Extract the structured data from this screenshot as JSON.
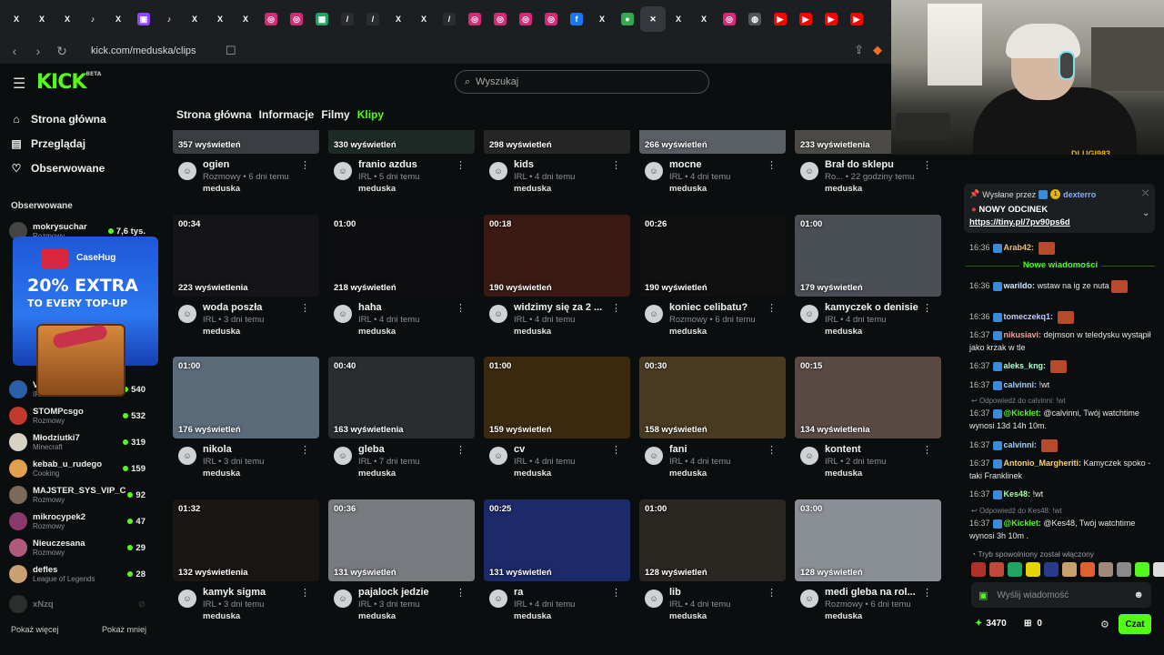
{
  "browser": {
    "tabs": [
      {
        "icon": "x-icon",
        "glyph": "X",
        "color": "#1c1f22"
      },
      {
        "icon": "x-icon",
        "glyph": "X",
        "color": "#1c1f22"
      },
      {
        "icon": "x-icon",
        "glyph": "X",
        "color": "#1c1f22"
      },
      {
        "icon": "tiktok-icon",
        "glyph": "♪",
        "color": "#1c1f22"
      },
      {
        "icon": "x-icon",
        "glyph": "X",
        "color": "#1c1f22"
      },
      {
        "icon": "twitch-icon",
        "glyph": "▣",
        "color": "#9146ff"
      },
      {
        "icon": "tiktok-icon",
        "glyph": "♪",
        "color": "#1c1f22"
      },
      {
        "icon": "x-icon",
        "glyph": "X",
        "color": "#1c1f22"
      },
      {
        "icon": "x-icon",
        "glyph": "X",
        "color": "#1c1f22"
      },
      {
        "icon": "x-icon",
        "glyph": "X",
        "color": "#1c1f22"
      },
      {
        "icon": "instagram-icon",
        "glyph": "◎",
        "color": "#d62976"
      },
      {
        "icon": "instagram-icon",
        "glyph": "◎",
        "color": "#d62976"
      },
      {
        "icon": "sheets-icon",
        "glyph": "▦",
        "color": "#1fa463"
      },
      {
        "icon": "stream-icon",
        "glyph": "/",
        "color": "#2a2d30"
      },
      {
        "icon": "stream-icon",
        "glyph": "/",
        "color": "#2a2d30"
      },
      {
        "icon": "x-icon",
        "glyph": "X",
        "color": "#1c1f22"
      },
      {
        "icon": "x-icon",
        "glyph": "X",
        "color": "#1c1f22"
      },
      {
        "icon": "stream-icon",
        "glyph": "/",
        "color": "#2a2d30"
      },
      {
        "icon": "instagram-icon",
        "glyph": "◎",
        "color": "#d62976"
      },
      {
        "icon": "instagram-icon",
        "glyph": "◎",
        "color": "#d62976"
      },
      {
        "icon": "instagram-icon",
        "glyph": "◎",
        "color": "#d62976"
      },
      {
        "icon": "instagram-icon",
        "glyph": "◎",
        "color": "#d62976"
      },
      {
        "icon": "facebook-icon",
        "glyph": "f",
        "color": "#1877f2"
      },
      {
        "icon": "x-icon",
        "glyph": "X",
        "color": "#1c1f22"
      },
      {
        "icon": "chrome-icon",
        "glyph": "●",
        "color": "#34a853"
      },
      {
        "icon": "close-icon",
        "glyph": "✕",
        "color": "#35393d",
        "active": true
      },
      {
        "icon": "x-icon",
        "glyph": "X",
        "color": "#1c1f22"
      },
      {
        "icon": "x-icon",
        "glyph": "X",
        "color": "#1c1f22"
      },
      {
        "icon": "instagram-icon",
        "glyph": "◎",
        "color": "#d62976"
      },
      {
        "icon": "globe-icon",
        "glyph": "◍",
        "color": "#555"
      },
      {
        "icon": "youtube-icon",
        "glyph": "▶",
        "color": "#ff0000"
      },
      {
        "icon": "youtube-icon",
        "glyph": "▶",
        "color": "#ff0000"
      },
      {
        "icon": "youtube-icon",
        "glyph": "▶",
        "color": "#ff0000"
      },
      {
        "icon": "youtube-icon",
        "glyph": "▶",
        "color": "#ff0000"
      }
    ],
    "url": "kick.com/meduska/clips"
  },
  "brand": {
    "logo": "KICK",
    "beta": "BETA",
    "accent": "#53fc18"
  },
  "nav": [
    {
      "label": "Strona główna",
      "icon": "home-icon",
      "glyph": "⌂"
    },
    {
      "label": "Przeglądaj",
      "icon": "browse-icon",
      "glyph": "▤"
    },
    {
      "label": "Obserwowane",
      "icon": "heart-icon",
      "glyph": "♡"
    }
  ],
  "followed": {
    "heading": "Obserwowane",
    "channels": [
      {
        "name": "mokrysuchar",
        "category": "Rozmowy",
        "count": "7,6 tys.",
        "color": "#444"
      },
      {
        "name": "Voo",
        "category": "IRL",
        "count": "540",
        "color": "#2b5fa8"
      },
      {
        "name": "STOMPcsgo",
        "category": "Rozmowy",
        "count": "532",
        "color": "#c0392b"
      },
      {
        "name": "Młodziutki7",
        "category": "Minecraft",
        "count": "319",
        "color": "#d8d2c4"
      },
      {
        "name": "kebab_u_rudego",
        "category": "Cooking",
        "count": "159",
        "color": "#e0a050"
      },
      {
        "name": "MAJSTER_SYS_VIP_C",
        "category": "Rozmowy",
        "count": "92",
        "color": "#7a6a5a"
      },
      {
        "name": "mikrocypek2",
        "category": "Rozmowy",
        "count": "47",
        "color": "#8a3a6a"
      },
      {
        "name": "Nieuczesana",
        "category": "Rozmowy",
        "count": "29",
        "color": "#b05a7a"
      },
      {
        "name": "defles",
        "category": "League of Legends",
        "count": "28",
        "color": "#c9a070"
      },
      {
        "name": "xNzq",
        "category": "",
        "count": "",
        "color": "#555"
      }
    ],
    "show_more": "Pokaż więcej",
    "show_less": "Pokaż mniej"
  },
  "ad": {
    "brand": "CaseHug",
    "line1": "20% EXTRA",
    "line2": "TO EVERY TOP-UP"
  },
  "search": {
    "placeholder": "Wyszukaj"
  },
  "channel_tabs": [
    {
      "label": "Strona główna",
      "active": false
    },
    {
      "label": "Informacje",
      "active": false
    },
    {
      "label": "Filmy",
      "active": false
    },
    {
      "label": "Klipy",
      "active": true
    }
  ],
  "clips": [
    {
      "dur": "",
      "views": "357 wyświetleń",
      "title": "ogien",
      "cat": "Rozmowy",
      "age": "6 dni temu",
      "chan": "meduska",
      "bg": "#3a3d42"
    },
    {
      "dur": "",
      "views": "330 wyświetleń",
      "title": "franio azdus",
      "cat": "IRL",
      "age": "5 dni temu",
      "chan": "meduska",
      "bg": "#1e2a26"
    },
    {
      "dur": "",
      "views": "298 wyświetleń",
      "title": "kids",
      "cat": "IRL",
      "age": "4 dni temu",
      "chan": "meduska",
      "bg": "#262626"
    },
    {
      "dur": "",
      "views": "266 wyświetleń",
      "title": "mocne",
      "cat": "IRL",
      "age": "4 dni temu",
      "chan": "meduska",
      "bg": "#5a5f66"
    },
    {
      "dur": "",
      "views": "233 wyświetlenia",
      "title": "Brał do sklepu",
      "cat": "Ro...",
      "age": "22 godziny temu",
      "chan": "meduska",
      "bg": "#4c4a47"
    },
    {
      "dur": "00:34",
      "views": "223 wyświetlenia",
      "title": "woda poszła",
      "cat": "IRL",
      "age": "3 dni temu",
      "chan": "meduska",
      "bg": "#151518"
    },
    {
      "dur": "01:00",
      "views": "218 wyświetleń",
      "title": "haha",
      "cat": "IRL",
      "age": "4 dni temu",
      "chan": "meduska",
      "bg": "#0e0e10"
    },
    {
      "dur": "00:18",
      "views": "190 wyświetleń",
      "title": "widzimy się za 2 ...",
      "cat": "IRL",
      "age": "4 dni temu",
      "chan": "meduska",
      "bg": "#3a1a12"
    },
    {
      "dur": "00:26",
      "views": "190 wyświetleń",
      "title": "koniec celibatu?",
      "cat": "Rozmowy",
      "age": "6 dni temu",
      "chan": "meduska",
      "bg": "#101010"
    },
    {
      "dur": "01:00",
      "views": "179 wyświetleń",
      "title": "kamyczek o denisie",
      "cat": "IRL",
      "age": "4 dni temu",
      "chan": "meduska",
      "bg": "#4a4e55"
    },
    {
      "dur": "01:00",
      "views": "176 wyświetleń",
      "title": "nikola",
      "cat": "IRL",
      "age": "3 dni temu",
      "chan": "meduska",
      "bg": "#5b6b7a"
    },
    {
      "dur": "00:40",
      "views": "163 wyświetlenia",
      "title": "gleba",
      "cat": "IRL",
      "age": "7 dni temu",
      "chan": "meduska",
      "bg": "#2a2d30"
    },
    {
      "dur": "01:00",
      "views": "159 wyświetleń",
      "title": "cv",
      "cat": "IRL",
      "age": "4 dni temu",
      "chan": "meduska",
      "bg": "#3b2a10"
    },
    {
      "dur": "00:30",
      "views": "158 wyświetleń",
      "title": "fani",
      "cat": "IRL",
      "age": "4 dni temu",
      "chan": "meduska",
      "bg": "#4a3a22"
    },
    {
      "dur": "00:15",
      "views": "134 wyświetlenia",
      "title": "kontent",
      "cat": "IRL",
      "age": "2 dni temu",
      "chan": "meduska",
      "bg": "#5a4a44"
    },
    {
      "dur": "01:32",
      "views": "132 wyświetlenia",
      "title": "kamyk sigma",
      "cat": "IRL",
      "age": "3 dni temu",
      "chan": "meduska",
      "bg": "#1a1614"
    },
    {
      "dur": "00:36",
      "views": "131 wyświetleń",
      "title": "pajalock jedzie",
      "cat": "IRL",
      "age": "3 dni temu",
      "chan": "meduska",
      "bg": "#777a7e"
    },
    {
      "dur": "00:25",
      "views": "131 wyświetleń",
      "title": "ra",
      "cat": "IRL",
      "age": "4 dni temu",
      "chan": "meduska",
      "bg": "#1c2a6a"
    },
    {
      "dur": "01:00",
      "views": "128 wyświetleń",
      "title": "lib",
      "cat": "IRL",
      "age": "4 dni temu",
      "chan": "meduska",
      "bg": "#2a2622"
    },
    {
      "dur": "03:00",
      "views": "128 wyświetleń",
      "title": "medi gleba na rol...",
      "cat": "Rozmowy",
      "age": "6 dni temu",
      "chan": "meduska",
      "bg": "#8a8f96"
    }
  ],
  "webcam": {
    "overlay_user": "DLUGI983"
  },
  "chat": {
    "pinned_by_label": "Wysłane przez",
    "pinned_by_badge": "1",
    "pinned_by_user": "dexterro",
    "pinned_title": "NOWY ODCINEK",
    "pinned_link": "https://tiny.pl/7pv90ps6d",
    "new_messages": "Nowe wiadomości",
    "messages": [
      {
        "time": "16:36",
        "user": "Arab42:",
        "text": "",
        "color": "#e8c070",
        "emote": true
      },
      {
        "time": "16:36",
        "user": "warildo:",
        "text": "wstaw na ig ze nuta",
        "color": "#d0e8ff",
        "emote": true
      },
      {
        "time": "16:36",
        "user": "tomeczekq1:",
        "text": "",
        "color": "#c8c8ff",
        "emote": true
      },
      {
        "time": "16:37",
        "user": "nikusiavi:",
        "text": "dejmson w teledysku wystąpił jako krzak w tle",
        "color": "#f0a0a0",
        "emote": false
      },
      {
        "time": "16:37",
        "user": "aleks_kng:",
        "text": "",
        "color": "#b0ffd0",
        "emote": true
      },
      {
        "time": "16:37",
        "user": "calvinni:",
        "text": "!wt",
        "color": "#a0d0ff",
        "emote": false
      },
      {
        "time": "16:37",
        "user": "@Kicklet:",
        "text": "@calvinni, Twój watchtime wynosi 13d 14h 10m.",
        "color": "#53fc18",
        "emote": false,
        "reply": "Odpowiedź do calvinni: !wt"
      },
      {
        "time": "16:37",
        "user": "calvinni:",
        "text": "",
        "color": "#a0d0ff",
        "emote": true
      },
      {
        "time": "16:37",
        "user": "Antonio_Margheriti:",
        "text": "Kamyczek spoko - taki Franklinek",
        "color": "#ffd070",
        "emote": false
      },
      {
        "time": "16:37",
        "user": "Kes48:",
        "text": "!wt",
        "color": "#a0ffa0",
        "emote": false
      },
      {
        "time": "16:37",
        "user": "@Kicklet:",
        "text": "@Kes48, Twój watchtime wynosi 3h 10m .",
        "color": "#53fc18",
        "emote": false,
        "reply": "Odpowiedź do Kes48: !wt"
      }
    ],
    "slowmode": "Tryb spowolniony został włączony",
    "input_placeholder": "Wyślij wiadomość",
    "points": "3470",
    "gifts": "0",
    "send_label": "Czat"
  }
}
